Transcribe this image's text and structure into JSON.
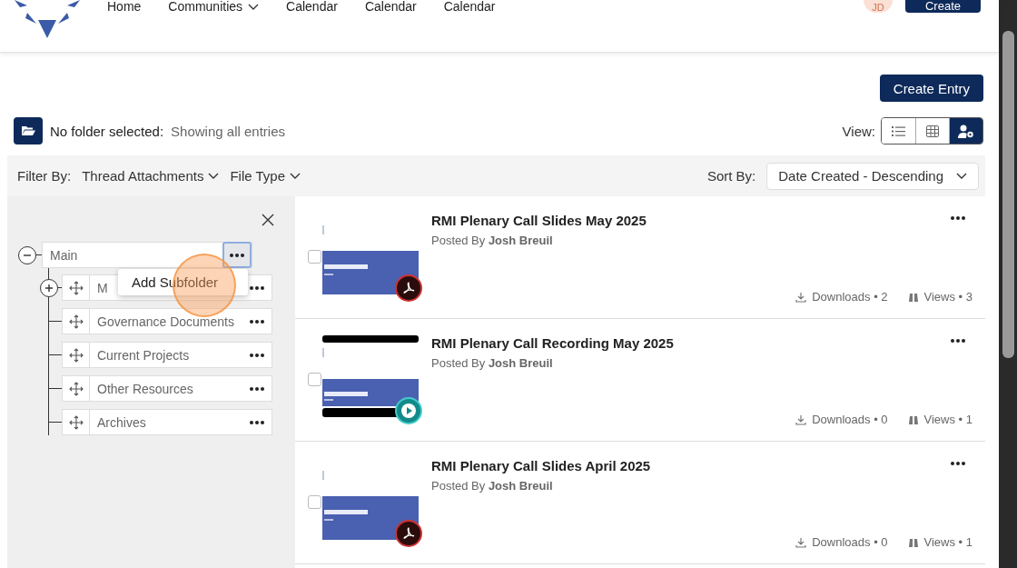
{
  "nav": {
    "items": [
      {
        "label": "Home",
        "has_caret": false
      },
      {
        "label": "Communities",
        "has_caret": true
      },
      {
        "label": "Calendar",
        "has_caret": false
      },
      {
        "label": "Calendar",
        "has_caret": false
      },
      {
        "label": "Calendar",
        "has_caret": false
      }
    ],
    "avatar": "JD",
    "create_button": "Create"
  },
  "create_entry_button": "Create Entry",
  "folder_status": {
    "label": "No folder selected:",
    "detail": "Showing all entries"
  },
  "view": {
    "label": "View:",
    "options": [
      {
        "kind": "list",
        "selected": false
      },
      {
        "kind": "grid",
        "selected": false
      },
      {
        "kind": "user-settings",
        "selected": true
      }
    ]
  },
  "filter": {
    "label": "Filter By:",
    "dropdowns": [
      "Thread Attachments",
      "File Type"
    ]
  },
  "sort": {
    "label": "Sort By:",
    "value": "Date Created - Descending"
  },
  "tree": {
    "label": "Main",
    "expanded": true,
    "menu_open": true,
    "children": [
      {
        "label": "M",
        "expandable": true
      },
      {
        "label": "Governance Documents",
        "expandable": false
      },
      {
        "label": "Current Projects",
        "expandable": false
      },
      {
        "label": "Other Resources",
        "expandable": false
      },
      {
        "label": "Archives",
        "expandable": false
      }
    ]
  },
  "context_menu": {
    "items": [
      "Add Subfolder"
    ]
  },
  "entries": [
    {
      "title": "RMI Plenary Call Slides May 2025",
      "posted_by_label": "Posted By",
      "author": "Josh Breuil",
      "kind": "pdf",
      "checked": false,
      "downloads": "Downloads • 2",
      "views": "Views • 3"
    },
    {
      "title": "RMI Plenary Call Recording May 2025",
      "posted_by_label": "Posted By",
      "author": "Josh Breuil",
      "kind": "video",
      "checked": false,
      "downloads": "Downloads • 0",
      "views": "Views • 1"
    },
    {
      "title": "RMI Plenary Call Slides April 2025",
      "posted_by_label": "Posted By",
      "author": "Josh Breuil",
      "kind": "pdf",
      "checked": false,
      "downloads": "Downloads • 0",
      "views": "Views • 1"
    }
  ]
}
